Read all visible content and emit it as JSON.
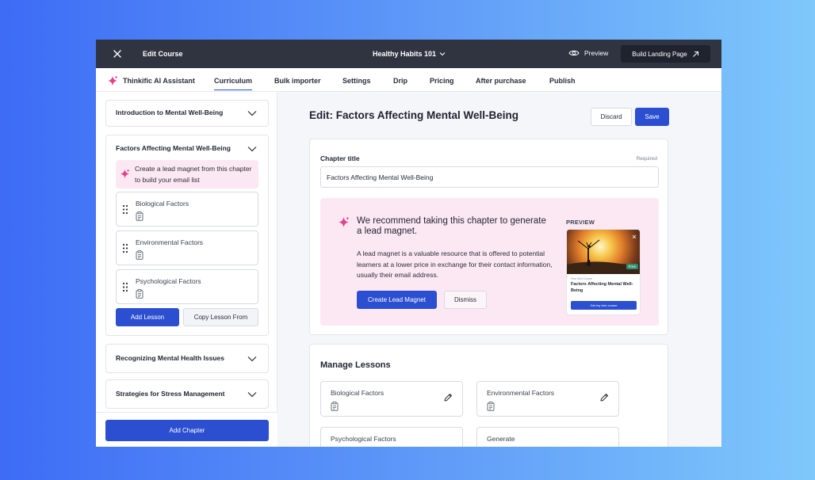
{
  "topbar": {
    "edit_label": "Edit Course",
    "course_name": "Healthy Habits 101",
    "preview_label": "Preview",
    "build_label": "Build Landing Page"
  },
  "tabs": {
    "ai_assistant": "Thinkific AI Assistant",
    "items": [
      "Curriculum",
      "Bulk importer",
      "Settings",
      "Drip",
      "Pricing",
      "After purchase",
      "Publish"
    ],
    "active": "Curriculum"
  },
  "sidebar": {
    "chapters": [
      "Introduction to Mental Well-Being",
      "Factors Affecting Mental Well-Being",
      "Recognizing Mental Health Issues",
      "Strategies for Stress Management"
    ],
    "lead_tip": "Create a lead magnet from this chapter to build your email list",
    "lessons": [
      "Biological Factors",
      "Environmental Factors",
      "Psychological Factors"
    ],
    "add_lesson": "Add Lesson",
    "copy_lesson": "Copy Lesson From",
    "add_chapter": "Add Chapter"
  },
  "main": {
    "title": "Edit: Factors Affecting Mental Well-Being",
    "discard": "Discard",
    "save": "Save",
    "chapter_title_label": "Chapter title",
    "required_label": "Required",
    "chapter_title_value": "Factors Affecting Mental Well-Being",
    "recommend": {
      "heading": "We recommend taking this chapter to generate a lead magnet.",
      "body": "A lead magnet is a valuable resource that is offered to potential learners at a lower price in exchange for their contact information, usually their email address.",
      "create_btn": "Create Lead Magnet",
      "dismiss_btn": "Dismiss",
      "preview_label": "PREVIEW",
      "preview_card": {
        "badge": "Free",
        "small_text": "Free Mini Course",
        "title": "Factors Affecting Mental Well-Being",
        "cta": "Get my free course"
      }
    },
    "manage_lessons": {
      "title": "Manage Lessons",
      "tiles": [
        "Biological Factors",
        "Environmental Factors",
        "Psychological Factors",
        "Generate"
      ]
    }
  },
  "colors": {
    "primary": "#2b4fd0",
    "topbar": "#2f3440",
    "pink_bg": "#fce8f3",
    "sparkle": "#e0438a"
  }
}
